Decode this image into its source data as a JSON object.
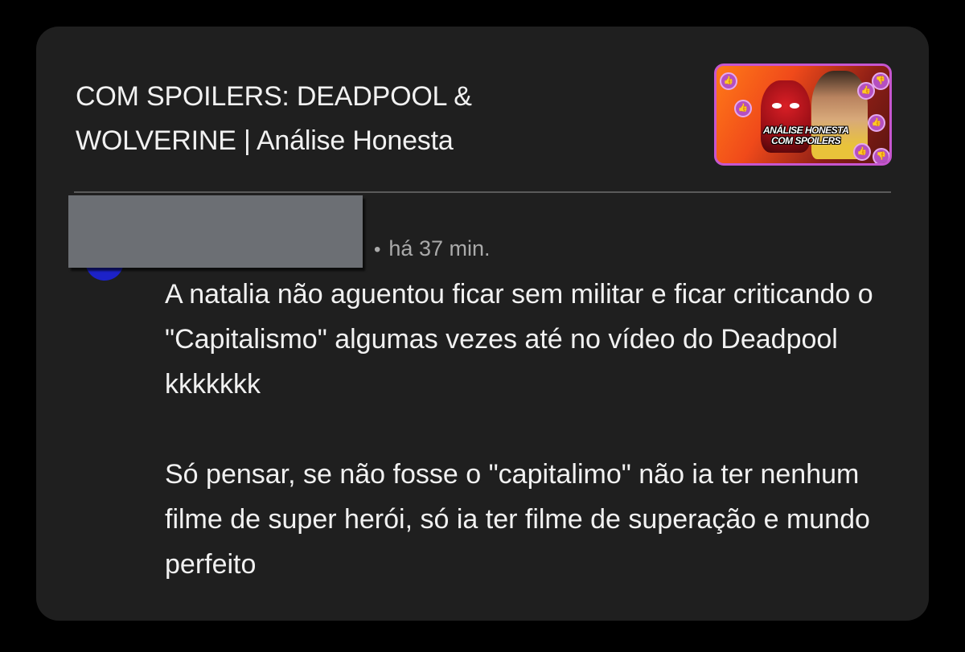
{
  "video": {
    "title_line1": "COM SPOILERS: DEADPOOL &",
    "title_line2": "WOLVERINE | Análise Honesta",
    "thumbnail_caption_line1": "ANÁLISE HONESTA",
    "thumbnail_caption_line2": "COM SPOILERS",
    "thumbnail_border_color": "#c656cf"
  },
  "comment": {
    "time": "há 37 min.",
    "separator": "•",
    "paragraph1": "A natalia não aguentou ficar sem militar e ficar criticando o \"Capitalismo\" algumas vezes até no vídeo do Deadpool kkkkkkk",
    "paragraph2": "Só pensar, se não fosse o \"capitalimo\" não ia ter nenhum filme de super herói, só ia ter filme de superação e mundo perfeito",
    "avatar_color": "#1c22c8"
  },
  "theme": {
    "background": "#000000",
    "card": "#1f1f1f",
    "text": "#f1f1f1",
    "muted": "#aaaaaa",
    "redaction": "#6c6f74"
  }
}
